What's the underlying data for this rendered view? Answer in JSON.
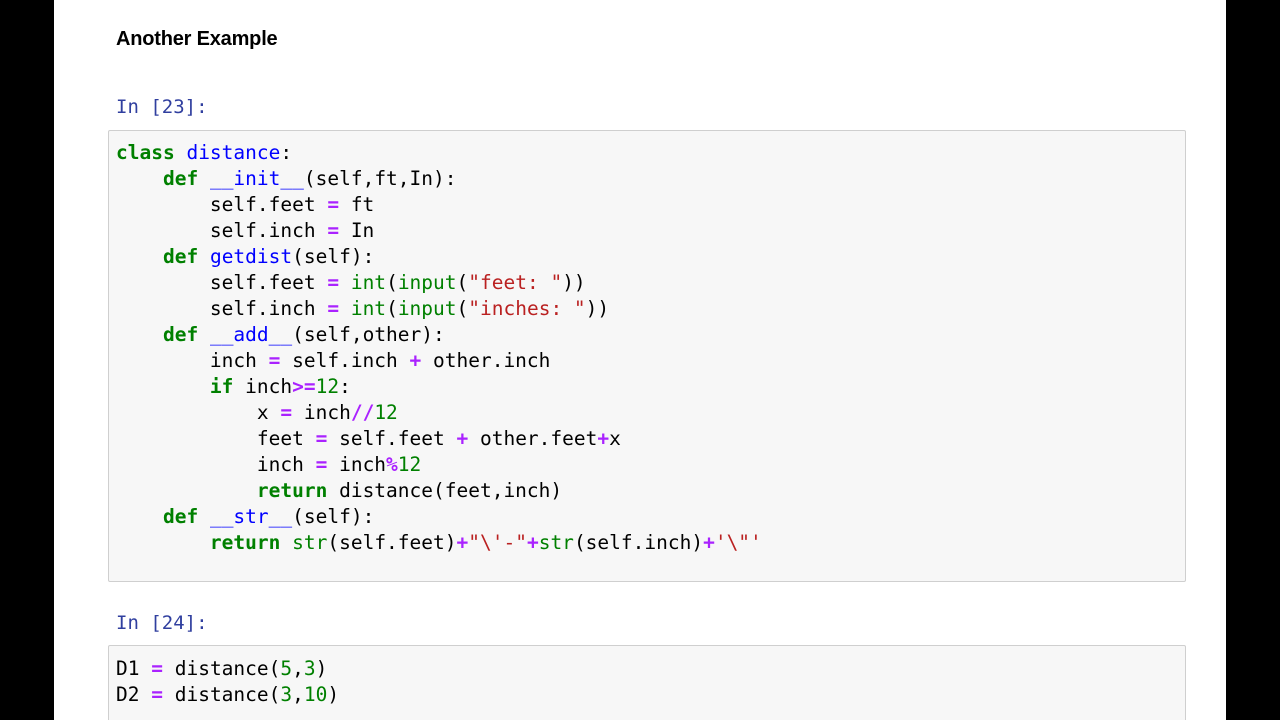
{
  "heading": "Another Example",
  "cells": [
    {
      "prompt": "In [23]:",
      "lines": [
        [
          [
            "kw",
            "class"
          ],
          [
            "",
            "",
            " "
          ],
          [
            "fn",
            "distance"
          ],
          [
            "",
            ":"
          ]
        ],
        [
          [
            "",
            "    "
          ],
          [
            "kw",
            "def"
          ],
          [
            "",
            "",
            " "
          ],
          [
            "fn",
            "__init__"
          ],
          [
            "",
            "(self,ft,In):"
          ]
        ],
        [
          [
            "",
            "        self.feet "
          ],
          [
            "op",
            "="
          ],
          [
            "",
            " ft"
          ]
        ],
        [
          [
            "",
            "        self.inch "
          ],
          [
            "op",
            "="
          ],
          [
            "",
            " In"
          ]
        ],
        [
          [
            "",
            "    "
          ],
          [
            "kw",
            "def"
          ],
          [
            "",
            " "
          ],
          [
            "fn",
            "getdist"
          ],
          [
            "",
            "(self):"
          ]
        ],
        [
          [
            "",
            "        self.feet "
          ],
          [
            "op",
            "="
          ],
          [
            "",
            " "
          ],
          [
            "bi",
            "int"
          ],
          [
            "",
            "("
          ],
          [
            "bi",
            "input"
          ],
          [
            "",
            "("
          ],
          [
            "str",
            "\"feet: \""
          ],
          [
            "",
            "))"
          ]
        ],
        [
          [
            "",
            "        self.inch "
          ],
          [
            "op",
            "="
          ],
          [
            "",
            " "
          ],
          [
            "bi",
            "int"
          ],
          [
            "",
            "("
          ],
          [
            "bi",
            "input"
          ],
          [
            "",
            "("
          ],
          [
            "str",
            "\"inches: \""
          ],
          [
            "",
            "))"
          ]
        ],
        [
          [
            "",
            "    "
          ],
          [
            "kw",
            "def"
          ],
          [
            "",
            " "
          ],
          [
            "fn",
            "__add__"
          ],
          [
            "",
            "(self,other):"
          ]
        ],
        [
          [
            "",
            "        inch "
          ],
          [
            "op",
            "="
          ],
          [
            "",
            " self.inch "
          ],
          [
            "op",
            "+"
          ],
          [
            "",
            " other.inch"
          ]
        ],
        [
          [
            "",
            "        "
          ],
          [
            "kw",
            "if"
          ],
          [
            "",
            " inch"
          ],
          [
            "op",
            ">="
          ],
          [
            "num",
            "12"
          ],
          [
            "",
            ":"
          ]
        ],
        [
          [
            "",
            "            x "
          ],
          [
            "op",
            "="
          ],
          [
            "",
            " inch"
          ],
          [
            "op",
            "//"
          ],
          [
            "num",
            "12"
          ]
        ],
        [
          [
            "",
            "            feet "
          ],
          [
            "op",
            "="
          ],
          [
            "",
            " self.feet "
          ],
          [
            "op",
            "+"
          ],
          [
            "",
            " other.feet"
          ],
          [
            "op",
            "+"
          ],
          [
            "",
            "x"
          ]
        ],
        [
          [
            "",
            "            inch "
          ],
          [
            "op",
            "="
          ],
          [
            "",
            " inch"
          ],
          [
            "op",
            "%"
          ],
          [
            "num",
            "12"
          ]
        ],
        [
          [
            "",
            "            "
          ],
          [
            "kw",
            "return"
          ],
          [
            "",
            " distance(feet,inch)"
          ]
        ],
        [
          [
            "",
            "    "
          ],
          [
            "kw",
            "def"
          ],
          [
            "",
            " "
          ],
          [
            "fn",
            "__str__"
          ],
          [
            "",
            "(self):"
          ]
        ],
        [
          [
            "",
            "        "
          ],
          [
            "kw",
            "return"
          ],
          [
            "",
            " "
          ],
          [
            "bi",
            "str"
          ],
          [
            "",
            "(self.feet)"
          ],
          [
            "op",
            "+"
          ],
          [
            "str",
            "\"\\'-\""
          ],
          [
            "op",
            "+"
          ],
          [
            "bi",
            "str"
          ],
          [
            "",
            "(self.inch)"
          ],
          [
            "op",
            "+"
          ],
          [
            "str",
            "'\\\"'"
          ]
        ]
      ]
    },
    {
      "prompt": "In [24]:",
      "lines": [
        [
          [
            "",
            "D1 "
          ],
          [
            "op",
            "="
          ],
          [
            "",
            " distance("
          ],
          [
            "num",
            "5"
          ],
          [
            "",
            ","
          ],
          [
            "num",
            "3"
          ],
          [
            "",
            ")"
          ]
        ],
        [
          [
            "",
            "D2 "
          ],
          [
            "op",
            "="
          ],
          [
            "",
            " distance("
          ],
          [
            "num",
            "3"
          ],
          [
            "",
            ","
          ],
          [
            "num",
            "10"
          ],
          [
            "",
            ")"
          ]
        ]
      ]
    }
  ]
}
